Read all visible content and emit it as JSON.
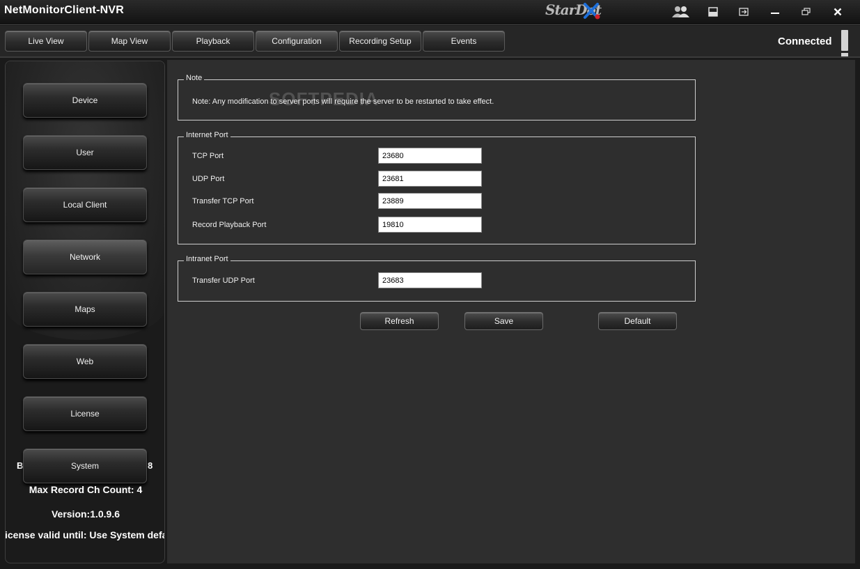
{
  "window": {
    "title": "NetMonitorClient-NVR",
    "logo_text": "StarDot",
    "controls": [
      "users-icon",
      "layout-icon",
      "logout-icon",
      "minimize-icon",
      "restore-icon",
      "close-icon"
    ]
  },
  "tabs": [
    {
      "label": "Live View"
    },
    {
      "label": "Map View"
    },
    {
      "label": "Playback"
    },
    {
      "label": "Configuration",
      "active": true
    },
    {
      "label": "Recording Setup"
    },
    {
      "label": "Events"
    }
  ],
  "connection_status": "Connected",
  "sidebar": {
    "items": [
      {
        "label": "Device"
      },
      {
        "label": "User"
      },
      {
        "label": "Local Client"
      },
      {
        "label": "Network",
        "active": true
      },
      {
        "label": "Maps"
      },
      {
        "label": "Web"
      },
      {
        "label": "License"
      },
      {
        "label": "System"
      }
    ],
    "partial_left": "B",
    "partial_right": "8",
    "max_record": "Max Record Ch Count: 4",
    "version": "Version:1.0.9.6",
    "license": "icense valid until: Use System defau"
  },
  "note_group": {
    "legend": "Note",
    "text": "Note: Any modification to server ports will require the server to be restarted to take effect.",
    "watermark": "SOFTPEDIA"
  },
  "internet_port": {
    "legend": "Internet Port",
    "fields": [
      {
        "label": "TCP Port",
        "value": "23680"
      },
      {
        "label": "UDP Port",
        "value": "23681"
      },
      {
        "label": "Transfer TCP Port",
        "value": "23889"
      },
      {
        "label": "Record Playback Port",
        "value": "19810"
      }
    ]
  },
  "intranet_port": {
    "legend": "Intranet Port",
    "fields": [
      {
        "label": "Transfer UDP Port",
        "value": "23683"
      }
    ]
  },
  "actions": {
    "refresh": "Refresh",
    "save": "Save",
    "default": "Default"
  },
  "colors": {
    "background": "#2e2e2e",
    "titlebar": "#121212",
    "logo_accent": "#1e6fd9",
    "logo_red": "#d0202a"
  }
}
